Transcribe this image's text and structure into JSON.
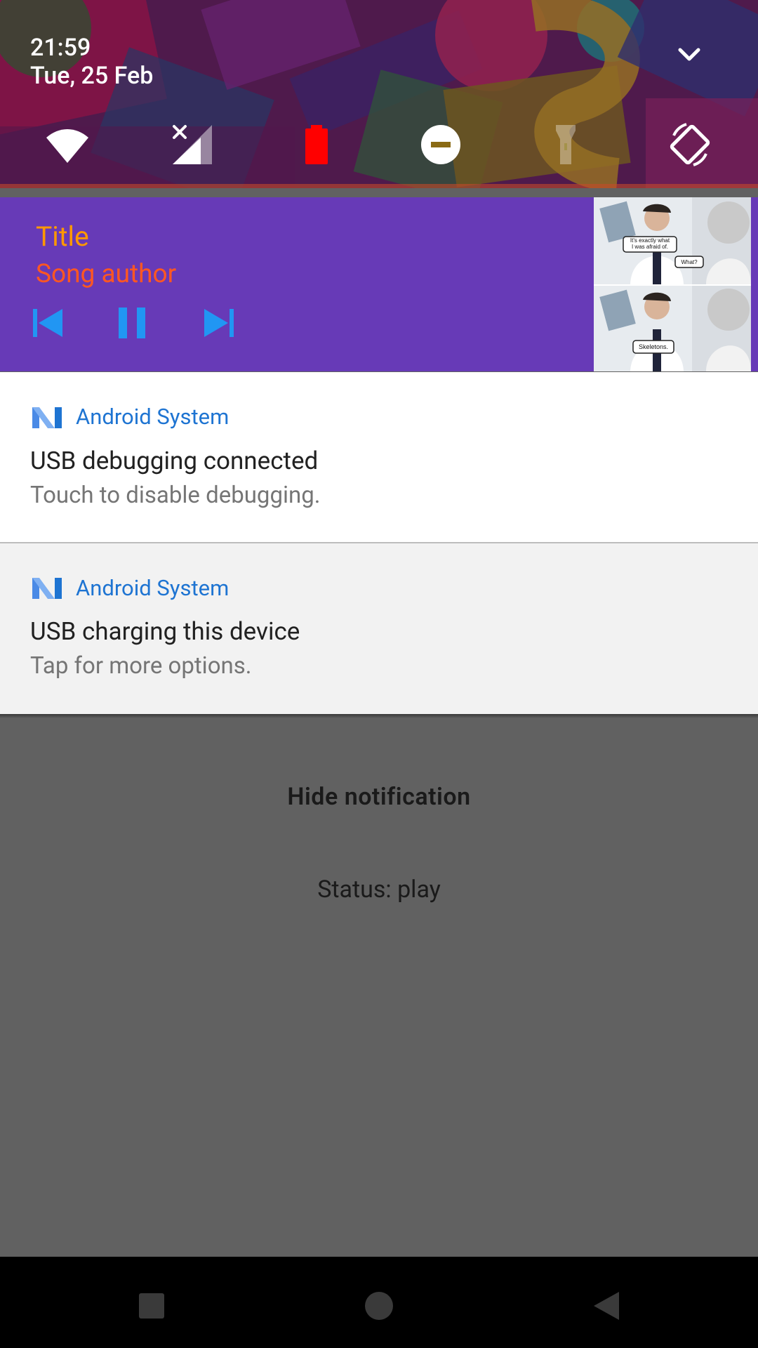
{
  "status_header": {
    "time": "21:59",
    "date": "Tue, 25 Feb",
    "expand_icon": "chevron-down-icon"
  },
  "quick_settings": {
    "tiles": [
      {
        "name": "wifi",
        "icon": "wifi-icon",
        "state": "on"
      },
      {
        "name": "mobile-data",
        "icon": "cellular-no-signal-icon",
        "state": "no-sim"
      },
      {
        "name": "battery",
        "icon": "battery-icon",
        "state": "low",
        "color": "#ff0000"
      },
      {
        "name": "do-not-disturb",
        "icon": "do-not-disturb-icon",
        "state": "on"
      },
      {
        "name": "flashlight",
        "icon": "flashlight-icon",
        "state": "disabled"
      },
      {
        "name": "auto-rotate",
        "icon": "auto-rotate-icon",
        "state": "on"
      }
    ]
  },
  "media_notification": {
    "title": "Title",
    "artist": "Song author",
    "background_color": "#673ab7",
    "title_color": "#ff9800",
    "artist_color": "#ff5722",
    "controls": [
      {
        "name": "previous",
        "icon": "skip-previous-icon"
      },
      {
        "name": "pause",
        "icon": "pause-icon"
      },
      {
        "name": "next",
        "icon": "skip-next-icon"
      }
    ],
    "album_art": {
      "bubbles": [
        "It's exactly what I was afraid of.",
        "What?",
        "Skeletons."
      ]
    }
  },
  "notifications": [
    {
      "app": "Android System",
      "title": "USB debugging connected",
      "text": "Touch to disable debugging."
    },
    {
      "app": "Android System",
      "title": "USB charging this device",
      "text": "Tap for more options."
    }
  ],
  "app_content": {
    "hide_button_label": "Hide notification",
    "status_text": "Status: play"
  },
  "nav_bar": {
    "buttons": [
      {
        "name": "recents",
        "icon": "recents-square-icon"
      },
      {
        "name": "home",
        "icon": "home-circle-icon"
      },
      {
        "name": "back",
        "icon": "back-triangle-icon"
      }
    ]
  },
  "colors": {
    "accent_blue": "#1e74d2",
    "media_button": "#2196f3",
    "scrim": "#616161"
  }
}
